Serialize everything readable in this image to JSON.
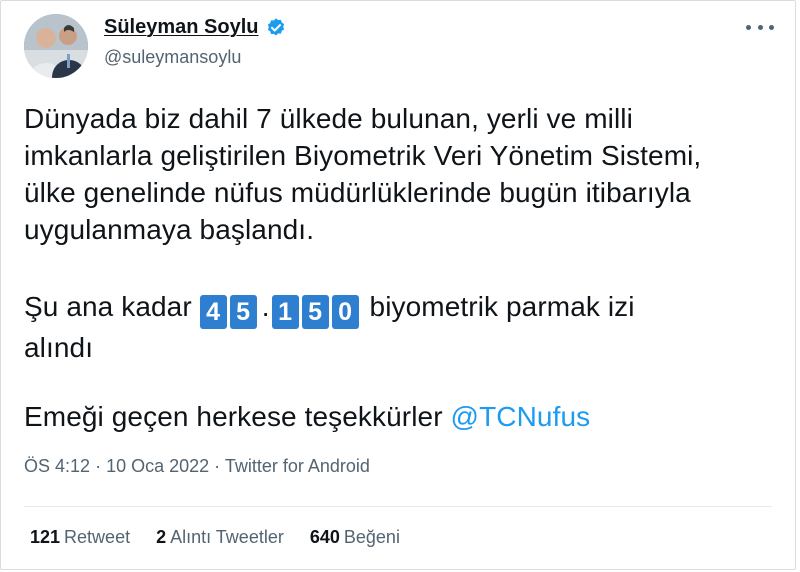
{
  "author": {
    "name": "Süleyman Soylu",
    "handle": "@suleymansoylu"
  },
  "tweet": {
    "paragraph1_lines": [
      "Dünyada biz dahil 7 ülkede bulunan, yerli ve milli",
      "imkanlarla geliştirilen Biyometrik Veri Yönetim Sistemi,",
      "ülke genelinde nüfus müdürlüklerinde bugün itibarıyla",
      "uygulanmaya başlandı."
    ],
    "counter_prefix": "Şu ana kadar",
    "counter_digits": [
      "4",
      "5",
      "1",
      "5",
      "0"
    ],
    "counter_separator": ".",
    "counter_suffix": "biyometrik parmak izi",
    "counter_suffix_line2": "alındı",
    "thanks_text": "Emeği geçen herkese teşekkürler",
    "mention": "@TCNufus"
  },
  "meta": {
    "time": "ÖS 4:12",
    "date": "10 Oca 2022",
    "source": "Twitter for Android",
    "separator": "·"
  },
  "stats": {
    "retweets_count": "121",
    "retweets_label": "Retweet",
    "quotes_count": "2",
    "quotes_label": "Alıntı Tweetler",
    "likes_count": "640",
    "likes_label": "Beğeni"
  },
  "colors": {
    "accent": "#1d9bf0",
    "digit_bg": "#2f7fd1",
    "muted": "#536471"
  },
  "icons": [
    "verified-badge-icon",
    "more-options-icon",
    "profile-photo"
  ]
}
